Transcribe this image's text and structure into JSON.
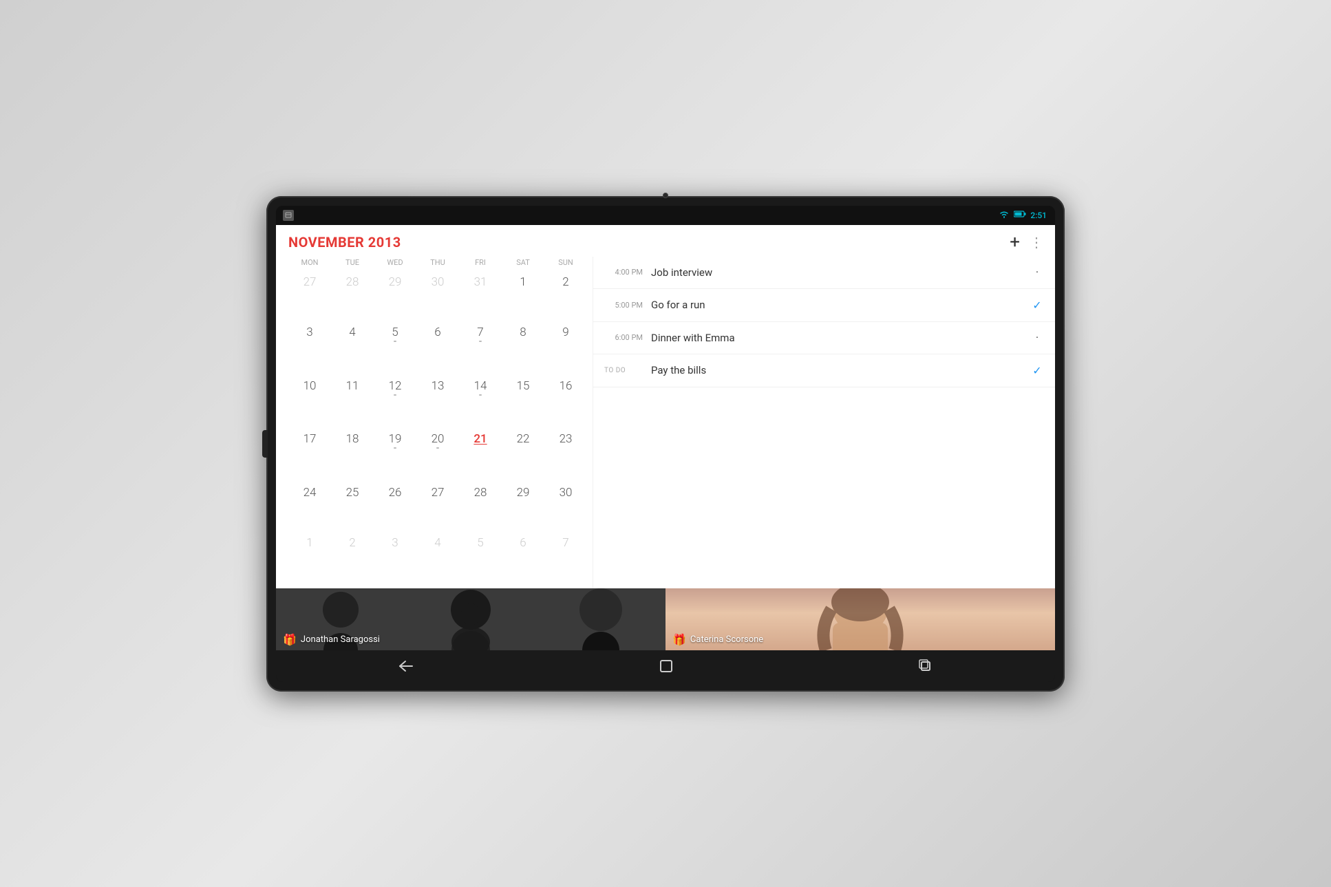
{
  "device": {
    "status_bar": {
      "time": "2:51"
    }
  },
  "header": {
    "month_title": "NOVEMBER 2013",
    "add_label": "+",
    "more_label": "⋮"
  },
  "calendar": {
    "day_headers": [
      "MON",
      "TUE",
      "WED",
      "THU",
      "FRI",
      "SAT",
      "SUN"
    ],
    "weeks": [
      [
        {
          "num": "27",
          "type": "prev"
        },
        {
          "num": "28",
          "type": "prev"
        },
        {
          "num": "29",
          "type": "prev"
        },
        {
          "num": "30",
          "type": "prev"
        },
        {
          "num": "31",
          "type": "prev"
        },
        {
          "num": "1",
          "type": "current"
        },
        {
          "num": "2",
          "type": "current"
        }
      ],
      [
        {
          "num": "3",
          "type": "current"
        },
        {
          "num": "4",
          "type": "current"
        },
        {
          "num": "5",
          "type": "current",
          "dot": true
        },
        {
          "num": "6",
          "type": "current"
        },
        {
          "num": "7",
          "type": "current",
          "dot": true
        },
        {
          "num": "8",
          "type": "current"
        },
        {
          "num": "9",
          "type": "current"
        }
      ],
      [
        {
          "num": "10",
          "type": "current"
        },
        {
          "num": "11",
          "type": "current"
        },
        {
          "num": "12",
          "type": "current",
          "dot": true
        },
        {
          "num": "13",
          "type": "current"
        },
        {
          "num": "14",
          "type": "current",
          "dot": true
        },
        {
          "num": "15",
          "type": "current"
        },
        {
          "num": "16",
          "type": "current"
        }
      ],
      [
        {
          "num": "17",
          "type": "current"
        },
        {
          "num": "18",
          "type": "current"
        },
        {
          "num": "19",
          "type": "current",
          "dot": true
        },
        {
          "num": "20",
          "type": "current",
          "dot": true
        },
        {
          "num": "21",
          "type": "today"
        },
        {
          "num": "22",
          "type": "current"
        },
        {
          "num": "23",
          "type": "current"
        }
      ],
      [
        {
          "num": "24",
          "type": "current"
        },
        {
          "num": "25",
          "type": "current"
        },
        {
          "num": "26",
          "type": "current"
        },
        {
          "num": "27",
          "type": "current"
        },
        {
          "num": "28",
          "type": "current"
        },
        {
          "num": "29",
          "type": "current"
        },
        {
          "num": "30",
          "type": "current"
        }
      ],
      [
        {
          "num": "1",
          "type": "next"
        },
        {
          "num": "2",
          "type": "next"
        },
        {
          "num": "3",
          "type": "next"
        },
        {
          "num": "4",
          "type": "next"
        },
        {
          "num": "5",
          "type": "next"
        },
        {
          "num": "6",
          "type": "next"
        },
        {
          "num": "7",
          "type": "next"
        }
      ]
    ]
  },
  "agenda": {
    "items": [
      {
        "time": "4:00 PM",
        "label": "Job interview",
        "status": "dot",
        "is_todo": false
      },
      {
        "time": "5:00 PM",
        "label": "Go for a run",
        "status": "check",
        "is_todo": false
      },
      {
        "time": "6:00 PM",
        "label": "Dinner with Emma",
        "status": "dot",
        "is_todo": false
      },
      {
        "time": "",
        "label": "Pay the bills",
        "status": "check",
        "is_todo": true
      }
    ],
    "todo_label": "TO DO"
  },
  "birthdays": [
    {
      "name": "Jonathan Saragossi",
      "gift_icon": "🎁"
    },
    {
      "name": "Caterina Scorsone",
      "gift_icon": "🎁"
    }
  ],
  "nav": {
    "back_icon": "←",
    "home_icon": "⬜",
    "recents_icon": "▣"
  }
}
